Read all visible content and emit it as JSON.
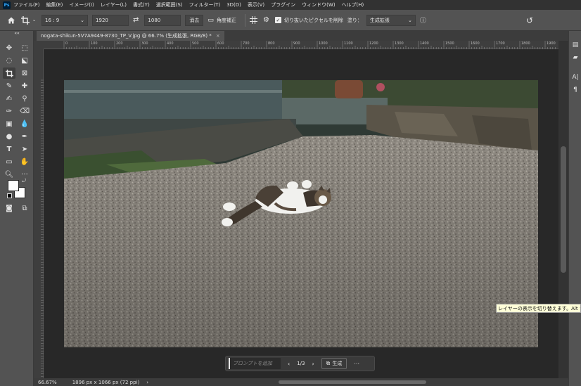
{
  "app": {
    "logo": "Ps",
    "menu": [
      "ファイル(F)",
      "編集(E)",
      "イメージ(I)",
      "レイヤー(L)",
      "書式(Y)",
      "選択範囲(S)",
      "フィルター(T)",
      "3D(D)",
      "表示(V)",
      "プラグイン",
      "ウィンドウ(W)",
      "ヘルプ(H)"
    ]
  },
  "options": {
    "ratio": "16 : 9",
    "width": "1920",
    "height": "1080",
    "clear_label": "消去",
    "straighten_label": "角度補正",
    "delete_cropped_label": "切り抜いたピクセルを削除",
    "fill_label": "塗り：",
    "fill_value": "生成拡張"
  },
  "document": {
    "tab_title": "nogata-shikun-5V7A9449-8730_TP_V.jpg @ 66.7% (生成拡張, RGB/8) *",
    "close": "×"
  },
  "ruler": {
    "labels": [
      "0",
      "100",
      "200",
      "300",
      "400",
      "500",
      "600",
      "700",
      "800",
      "900",
      "1000",
      "1100",
      "1200",
      "1300",
      "1400",
      "1500",
      "1600",
      "1700",
      "1800",
      "1900"
    ]
  },
  "taskbar": {
    "prompt_placeholder": "プロンプトを追加",
    "prev": "‹",
    "page": "1/3",
    "next": "›",
    "generate_label": "生成",
    "more": "···"
  },
  "status": {
    "zoom": "66.67%",
    "size": "1896 px x 1066 px (72 ppi)",
    "arrow": "›"
  },
  "tooltip": {
    "text": "レイヤーの表示を切り替えます。Alt キ"
  }
}
